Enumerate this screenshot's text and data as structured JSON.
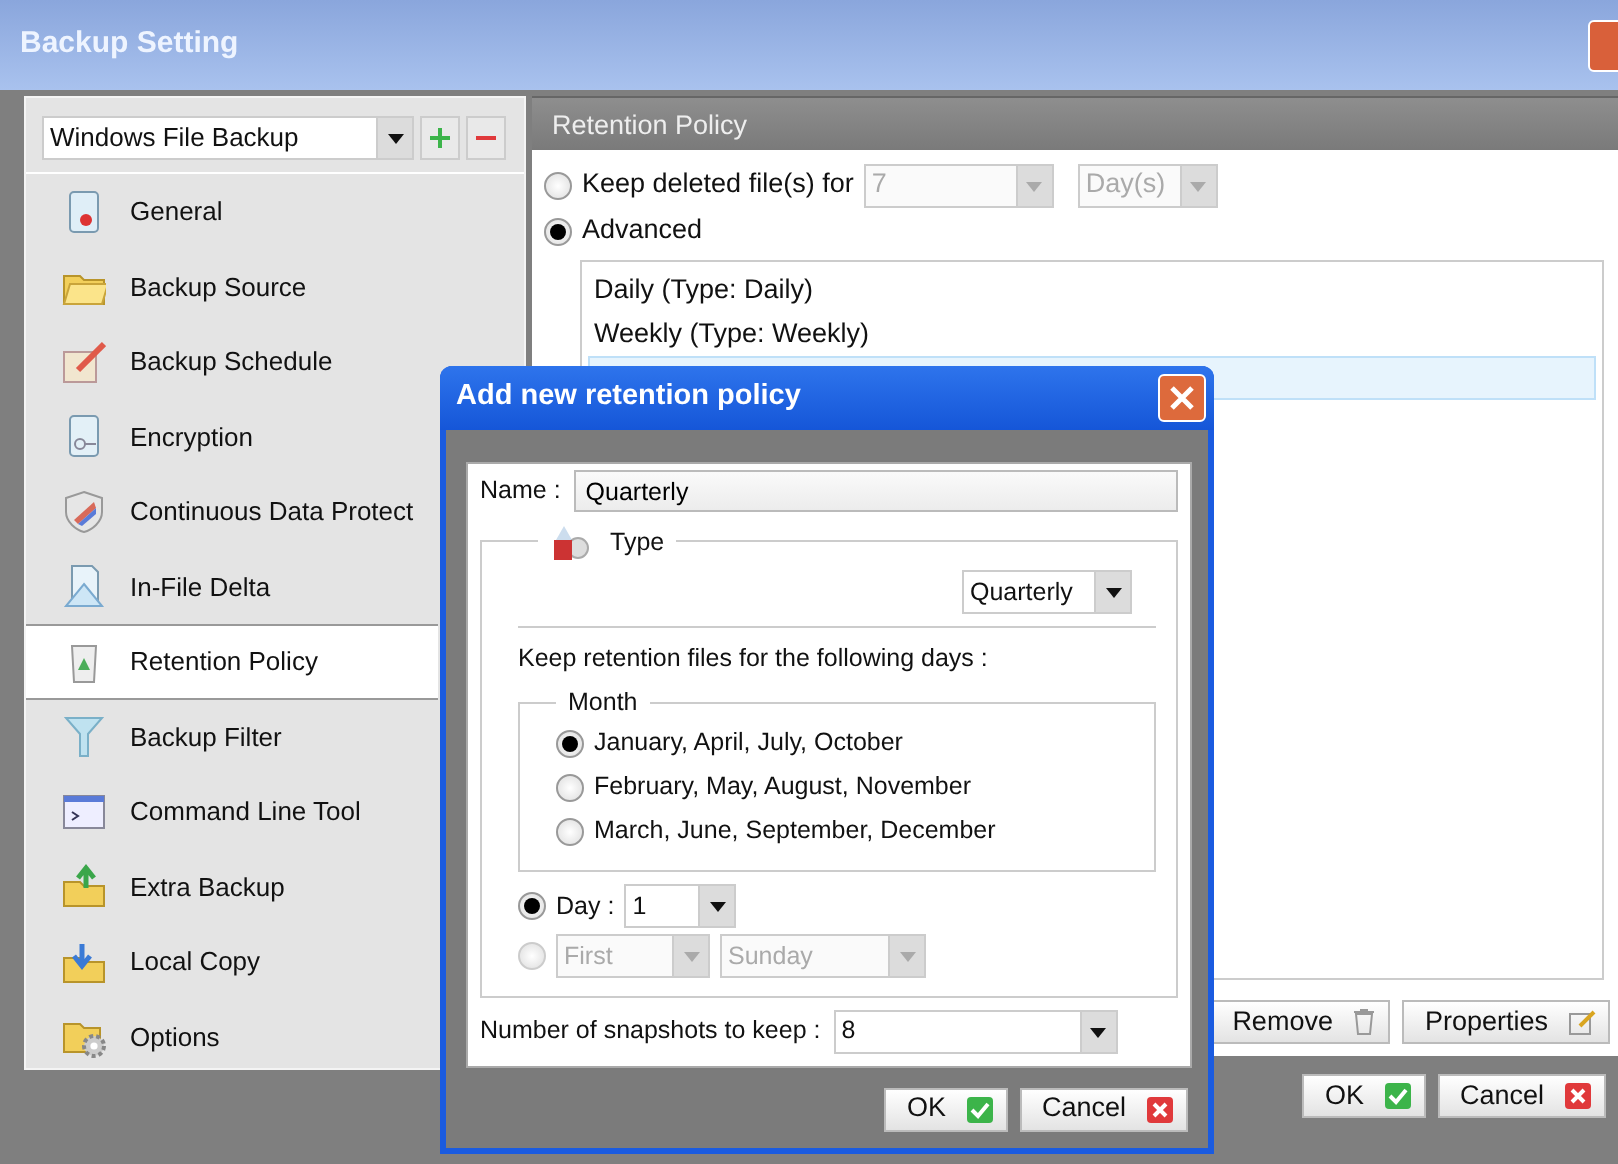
{
  "window": {
    "title": "Backup Setting"
  },
  "backup_set": {
    "value": "Windows File Backup"
  },
  "sidebar": {
    "items": [
      {
        "label": "General",
        "selected": false
      },
      {
        "label": "Backup Source",
        "selected": false
      },
      {
        "label": "Backup Schedule",
        "selected": false
      },
      {
        "label": "Encryption",
        "selected": false
      },
      {
        "label": "Continuous Data Protect",
        "selected": false
      },
      {
        "label": "In-File Delta",
        "selected": false
      },
      {
        "label": "Retention Policy",
        "selected": true
      },
      {
        "label": "Backup Filter",
        "selected": false
      },
      {
        "label": "Command Line Tool",
        "selected": false
      },
      {
        "label": "Extra Backup",
        "selected": false
      },
      {
        "label": "Local Copy",
        "selected": false
      },
      {
        "label": "Options",
        "selected": false
      }
    ]
  },
  "panel": {
    "title": "Retention Policy",
    "simple": {
      "label": "Keep deleted file(s) for",
      "selected": false,
      "count": "7",
      "unit": "Day(s)"
    },
    "advanced": {
      "label": "Advanced",
      "selected": true
    },
    "policies": [
      {
        "label": "Daily (Type: Daily)",
        "selected": false
      },
      {
        "label": "Weekly (Type: Weekly)",
        "selected": false
      },
      {
        "selected": true
      }
    ],
    "buttons": [
      {
        "label": "Remove",
        "kind": "remove"
      },
      {
        "label": "Properties",
        "kind": "edit"
      }
    ]
  },
  "footer_buttons": [
    {
      "label": "OK",
      "kind": "confirm"
    },
    {
      "label": "Cancel",
      "kind": "cancel"
    }
  ],
  "dialog": {
    "title": "Add new retention policy",
    "name_label": "Name :",
    "name_value": "Quarterly",
    "type_label": "Type",
    "type_value": "Quarterly",
    "days_label": "Keep retention files for the following days :",
    "month_label": "Month",
    "months": [
      {
        "label": "January, April, July, October",
        "selected": true
      },
      {
        "label": "February, May, August, November",
        "selected": false
      },
      {
        "label": "March, June, September, December",
        "selected": false
      }
    ],
    "day_option": {
      "label": "Day :",
      "value": "1",
      "selected": true
    },
    "weekday_option": {
      "ordinal": "First",
      "weekday": "Sunday",
      "selected": false
    },
    "snapshots_label": "Number of snapshots to keep :",
    "snapshots_value": "8",
    "buttons": [
      {
        "label": "OK",
        "kind": "confirm"
      },
      {
        "label": "Cancel",
        "kind": "cancel"
      }
    ]
  }
}
